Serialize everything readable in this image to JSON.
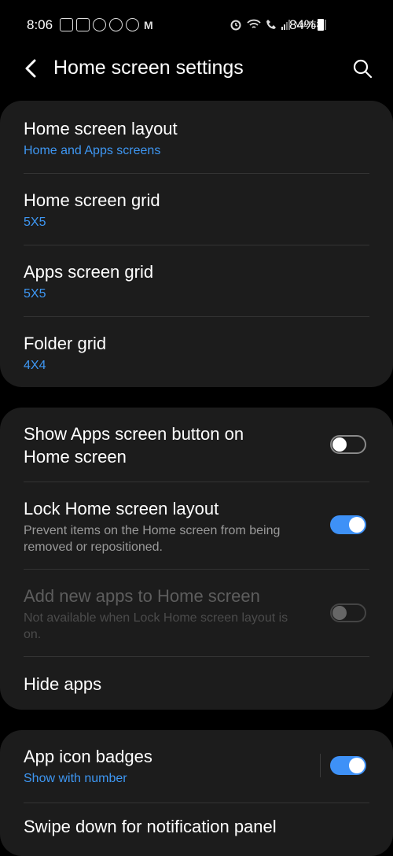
{
  "status_bar": {
    "time": "8:06",
    "battery": "84%",
    "left_icons": [
      "instagram-icon",
      "app-icon",
      "notification-icon",
      "notification-icon",
      "notification-icon",
      "gmail-icon"
    ],
    "right_icons": [
      "alarm-icon",
      "wifi-icon",
      "call-icon",
      "signal-icon",
      "volte-icon",
      "signal-icon"
    ],
    "volte_label": "VoLTE2"
  },
  "header": {
    "title": "Home screen settings"
  },
  "card1": {
    "home_layout": {
      "label": "Home screen layout",
      "value": "Home and Apps screens"
    },
    "home_grid": {
      "label": "Home screen grid",
      "value": "5X5"
    },
    "apps_grid": {
      "label": "Apps screen grid",
      "value": "5X5"
    },
    "folder_grid": {
      "label": "Folder grid",
      "value": "4X4"
    }
  },
  "card2": {
    "show_apps_button": {
      "label_line1": "Show Apps screen button on",
      "label_line2": "Home screen",
      "enabled": false
    },
    "lock_layout": {
      "label": "Lock Home screen layout",
      "desc_line1": "Prevent items on the Home screen from being",
      "desc_line2": "removed or repositioned.",
      "enabled": true
    },
    "add_new_apps": {
      "label": "Add new apps to Home screen",
      "desc_line1": "Not available when Lock Home screen layout is",
      "desc_line2": "on.",
      "enabled": false
    },
    "hide_apps": {
      "label": "Hide apps"
    }
  },
  "card3": {
    "badges": {
      "label": "App icon badges",
      "value": "Show with number",
      "enabled": true
    },
    "swipe_down": {
      "label": "Swipe down for notification panel"
    }
  },
  "colors": {
    "accent": "#3e97f3",
    "card": "#1c1c1c",
    "background": "#000000"
  }
}
